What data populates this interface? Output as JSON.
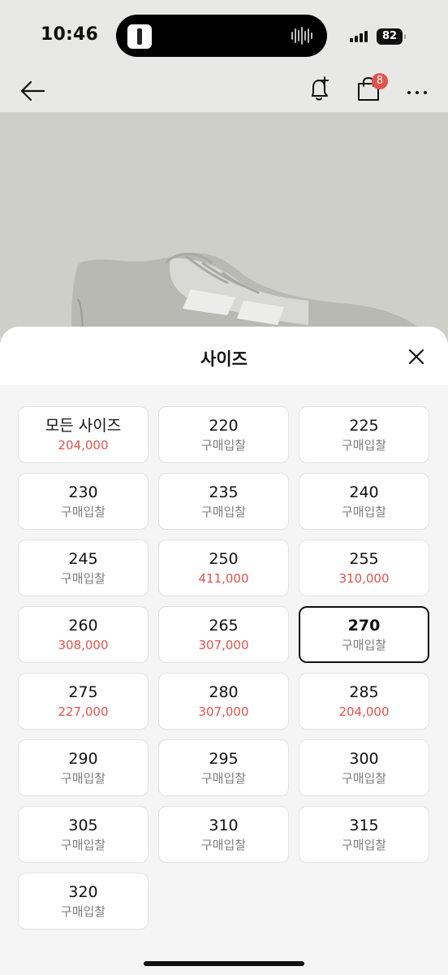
{
  "status_bar": {
    "time": "10:46",
    "battery": "82"
  },
  "nav": {
    "cart_badge": "8",
    "icons": [
      "back-arrow-icon",
      "bell-plus-icon",
      "shopping-bag-icon",
      "more-icon"
    ]
  },
  "sheet": {
    "title": "사이즈",
    "selected_size": "270",
    "sizes": [
      {
        "label": "모든 사이즈",
        "price": "204,000",
        "has_price": true
      },
      {
        "label": "220",
        "price": "구매입찰",
        "has_price": false
      },
      {
        "label": "225",
        "price": "구매입찰",
        "has_price": false
      },
      {
        "label": "230",
        "price": "구매입찰",
        "has_price": false
      },
      {
        "label": "235",
        "price": "구매입찰",
        "has_price": false
      },
      {
        "label": "240",
        "price": "구매입찰",
        "has_price": false
      },
      {
        "label": "245",
        "price": "구매입찰",
        "has_price": false
      },
      {
        "label": "250",
        "price": "411,000",
        "has_price": true
      },
      {
        "label": "255",
        "price": "310,000",
        "has_price": true
      },
      {
        "label": "260",
        "price": "308,000",
        "has_price": true
      },
      {
        "label": "265",
        "price": "307,000",
        "has_price": true
      },
      {
        "label": "270",
        "price": "구매입찰",
        "has_price": false
      },
      {
        "label": "275",
        "price": "227,000",
        "has_price": true
      },
      {
        "label": "280",
        "price": "307,000",
        "has_price": true
      },
      {
        "label": "285",
        "price": "204,000",
        "has_price": true
      },
      {
        "label": "290",
        "price": "구매입찰",
        "has_price": false
      },
      {
        "label": "295",
        "price": "구매입찰",
        "has_price": false
      },
      {
        "label": "300",
        "price": "구매입찰",
        "has_price": false
      },
      {
        "label": "305",
        "price": "구매입찰",
        "has_price": false
      },
      {
        "label": "310",
        "price": "구매입찰",
        "has_price": false
      },
      {
        "label": "315",
        "price": "구매입찰",
        "has_price": false
      },
      {
        "label": "320",
        "price": "구매입찰",
        "has_price": false
      }
    ]
  },
  "colors": {
    "price_red": "#e4524a",
    "bid_grey": "#7d7d7d",
    "badge": "#e4524a"
  }
}
